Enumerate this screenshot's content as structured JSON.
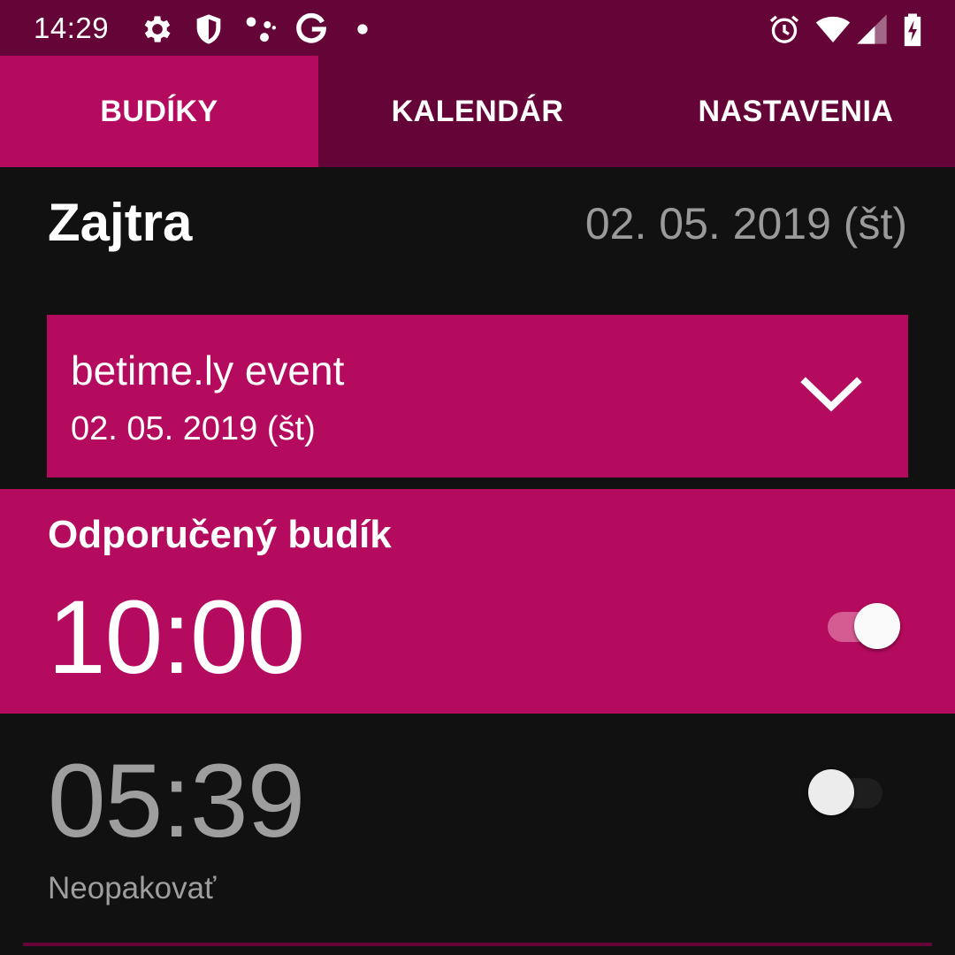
{
  "status_bar": {
    "time": "14:29",
    "icons_left": [
      "settings-icon",
      "shield-icon",
      "assistant-dots-icon",
      "google-icon",
      "dot-icon"
    ],
    "icons_right": [
      "alarm-clock-icon",
      "wifi-icon",
      "signal-icon",
      "battery-charging-icon"
    ]
  },
  "tabs": [
    {
      "label": "BUDÍKY",
      "active": true
    },
    {
      "label": "KALENDÁR",
      "active": false
    },
    {
      "label": "NASTAVENIA",
      "active": false
    }
  ],
  "day": {
    "title": "Zajtra",
    "date": "02. 05. 2019 (št)"
  },
  "event": {
    "title": "betime.ly event",
    "date": "02. 05. 2019 (št)",
    "expand_icon": "chevron-down-icon"
  },
  "recommended_alarm": {
    "label": "Odporučený budík",
    "time": "10:00",
    "enabled": true
  },
  "alarm": {
    "time": "05:39",
    "repeat": "Neopakovať",
    "enabled": false
  },
  "colors": {
    "primary_dark": "#650437",
    "accent": "#b50b5e",
    "background": "#111111",
    "muted_text": "#9e9e9e"
  }
}
